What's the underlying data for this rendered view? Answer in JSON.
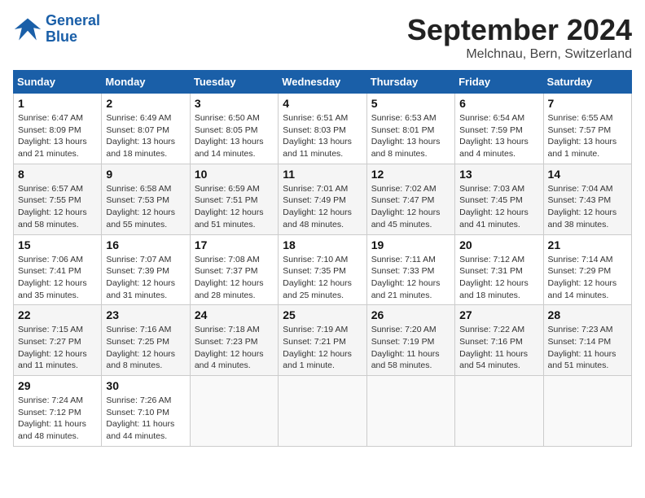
{
  "header": {
    "logo_line1": "General",
    "logo_line2": "Blue",
    "month_title": "September 2024",
    "subtitle": "Melchnau, Bern, Switzerland"
  },
  "columns": [
    "Sunday",
    "Monday",
    "Tuesday",
    "Wednesday",
    "Thursday",
    "Friday",
    "Saturday"
  ],
  "weeks": [
    [
      {
        "day": "1",
        "sunrise": "Sunrise: 6:47 AM",
        "sunset": "Sunset: 8:09 PM",
        "daylight": "Daylight: 13 hours and 21 minutes."
      },
      {
        "day": "2",
        "sunrise": "Sunrise: 6:49 AM",
        "sunset": "Sunset: 8:07 PM",
        "daylight": "Daylight: 13 hours and 18 minutes."
      },
      {
        "day": "3",
        "sunrise": "Sunrise: 6:50 AM",
        "sunset": "Sunset: 8:05 PM",
        "daylight": "Daylight: 13 hours and 14 minutes."
      },
      {
        "day": "4",
        "sunrise": "Sunrise: 6:51 AM",
        "sunset": "Sunset: 8:03 PM",
        "daylight": "Daylight: 13 hours and 11 minutes."
      },
      {
        "day": "5",
        "sunrise": "Sunrise: 6:53 AM",
        "sunset": "Sunset: 8:01 PM",
        "daylight": "Daylight: 13 hours and 8 minutes."
      },
      {
        "day": "6",
        "sunrise": "Sunrise: 6:54 AM",
        "sunset": "Sunset: 7:59 PM",
        "daylight": "Daylight: 13 hours and 4 minutes."
      },
      {
        "day": "7",
        "sunrise": "Sunrise: 6:55 AM",
        "sunset": "Sunset: 7:57 PM",
        "daylight": "Daylight: 13 hours and 1 minute."
      }
    ],
    [
      {
        "day": "8",
        "sunrise": "Sunrise: 6:57 AM",
        "sunset": "Sunset: 7:55 PM",
        "daylight": "Daylight: 12 hours and 58 minutes."
      },
      {
        "day": "9",
        "sunrise": "Sunrise: 6:58 AM",
        "sunset": "Sunset: 7:53 PM",
        "daylight": "Daylight: 12 hours and 55 minutes."
      },
      {
        "day": "10",
        "sunrise": "Sunrise: 6:59 AM",
        "sunset": "Sunset: 7:51 PM",
        "daylight": "Daylight: 12 hours and 51 minutes."
      },
      {
        "day": "11",
        "sunrise": "Sunrise: 7:01 AM",
        "sunset": "Sunset: 7:49 PM",
        "daylight": "Daylight: 12 hours and 48 minutes."
      },
      {
        "day": "12",
        "sunrise": "Sunrise: 7:02 AM",
        "sunset": "Sunset: 7:47 PM",
        "daylight": "Daylight: 12 hours and 45 minutes."
      },
      {
        "day": "13",
        "sunrise": "Sunrise: 7:03 AM",
        "sunset": "Sunset: 7:45 PM",
        "daylight": "Daylight: 12 hours and 41 minutes."
      },
      {
        "day": "14",
        "sunrise": "Sunrise: 7:04 AM",
        "sunset": "Sunset: 7:43 PM",
        "daylight": "Daylight: 12 hours and 38 minutes."
      }
    ],
    [
      {
        "day": "15",
        "sunrise": "Sunrise: 7:06 AM",
        "sunset": "Sunset: 7:41 PM",
        "daylight": "Daylight: 12 hours and 35 minutes."
      },
      {
        "day": "16",
        "sunrise": "Sunrise: 7:07 AM",
        "sunset": "Sunset: 7:39 PM",
        "daylight": "Daylight: 12 hours and 31 minutes."
      },
      {
        "day": "17",
        "sunrise": "Sunrise: 7:08 AM",
        "sunset": "Sunset: 7:37 PM",
        "daylight": "Daylight: 12 hours and 28 minutes."
      },
      {
        "day": "18",
        "sunrise": "Sunrise: 7:10 AM",
        "sunset": "Sunset: 7:35 PM",
        "daylight": "Daylight: 12 hours and 25 minutes."
      },
      {
        "day": "19",
        "sunrise": "Sunrise: 7:11 AM",
        "sunset": "Sunset: 7:33 PM",
        "daylight": "Daylight: 12 hours and 21 minutes."
      },
      {
        "day": "20",
        "sunrise": "Sunrise: 7:12 AM",
        "sunset": "Sunset: 7:31 PM",
        "daylight": "Daylight: 12 hours and 18 minutes."
      },
      {
        "day": "21",
        "sunrise": "Sunrise: 7:14 AM",
        "sunset": "Sunset: 7:29 PM",
        "daylight": "Daylight: 12 hours and 14 minutes."
      }
    ],
    [
      {
        "day": "22",
        "sunrise": "Sunrise: 7:15 AM",
        "sunset": "Sunset: 7:27 PM",
        "daylight": "Daylight: 12 hours and 11 minutes."
      },
      {
        "day": "23",
        "sunrise": "Sunrise: 7:16 AM",
        "sunset": "Sunset: 7:25 PM",
        "daylight": "Daylight: 12 hours and 8 minutes."
      },
      {
        "day": "24",
        "sunrise": "Sunrise: 7:18 AM",
        "sunset": "Sunset: 7:23 PM",
        "daylight": "Daylight: 12 hours and 4 minutes."
      },
      {
        "day": "25",
        "sunrise": "Sunrise: 7:19 AM",
        "sunset": "Sunset: 7:21 PM",
        "daylight": "Daylight: 12 hours and 1 minute."
      },
      {
        "day": "26",
        "sunrise": "Sunrise: 7:20 AM",
        "sunset": "Sunset: 7:19 PM",
        "daylight": "Daylight: 11 hours and 58 minutes."
      },
      {
        "day": "27",
        "sunrise": "Sunrise: 7:22 AM",
        "sunset": "Sunset: 7:16 PM",
        "daylight": "Daylight: 11 hours and 54 minutes."
      },
      {
        "day": "28",
        "sunrise": "Sunrise: 7:23 AM",
        "sunset": "Sunset: 7:14 PM",
        "daylight": "Daylight: 11 hours and 51 minutes."
      }
    ],
    [
      {
        "day": "29",
        "sunrise": "Sunrise: 7:24 AM",
        "sunset": "Sunset: 7:12 PM",
        "daylight": "Daylight: 11 hours and 48 minutes."
      },
      {
        "day": "30",
        "sunrise": "Sunrise: 7:26 AM",
        "sunset": "Sunset: 7:10 PM",
        "daylight": "Daylight: 11 hours and 44 minutes."
      },
      null,
      null,
      null,
      null,
      null
    ]
  ]
}
